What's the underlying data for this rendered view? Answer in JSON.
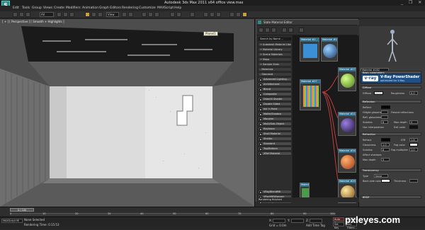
{
  "titlebar": {
    "app_logo": "S",
    "title": "Autodesk 3ds Max 2011 x64    office view.max",
    "window_controls": "_ ❐ ✕"
  },
  "menu": [
    "Edit",
    "Tools",
    "Group",
    "Views",
    "Create",
    "Modifiers",
    "Animation",
    "Graph Editors",
    "Rendering",
    "Customize",
    "MAXScript",
    "Help"
  ],
  "toolbar": {
    "selection_filter": "All",
    "reference_coord": "View"
  },
  "viewport": {
    "label": "[ + ] [ Perspective ] [ Smooth + Highlights ]",
    "badge": "Planel1"
  },
  "material_editor": {
    "title": "Slate Material Editor",
    "browser_items": [
      "Search by Name ...",
      "+ Autodesk Material Library",
      "+ Material Library",
      "+ Scene Materials",
      "+ Maps",
      "+ Sample Slots",
      "- Materials",
      "- Standard"
    ],
    "materials": [
      "Advanced Lighting...",
      "Architectural",
      "Blend",
      "Composite",
      "DirectX Shader",
      "Double Sided",
      "Ink 'n Paint",
      "Matte/Shadow",
      "Morpher",
      "Multi/Sub-Object",
      "Raytrace",
      "Shell Material",
      "Shellac",
      "Standard",
      "Top/Bottom",
      "XRef Material"
    ],
    "vray_items": [
      "VRayBlendMtl",
      "VRayMtlWrapper",
      "VRayLightMtl"
    ],
    "nodes": [
      {
        "label": "Material #1..."
      },
      {
        "label": "Material #27"
      },
      {
        "label": "Material #21"
      },
      {
        "label": "Material #24"
      },
      {
        "label": "Material #29"
      },
      {
        "label": "Material #30"
      }
    ],
    "status": "Rendering finished"
  },
  "params": {
    "material_name": "Material #182",
    "basic_params": "Basic parameters",
    "vray_title": "V-Ray PowerShader",
    "vray_sub": "optimized for V-Ray",
    "vray_logo": "v·ray",
    "diffuse_section": "Diffuse",
    "diffuse": "Diffuse",
    "roughness": "Roughness",
    "roughness_value": "0.0",
    "reflection_section": "Reflection",
    "reflect": "Reflect",
    "hilight_gloss": "Hilight glossiness",
    "refl_gloss": "Refl. glossiness",
    "subdivs": "Subdivs",
    "subdivs_value": "8",
    "use_interp": "Use interpolation",
    "fresnel": "Fresnel reflections",
    "max_depth": "Max depth",
    "max_depth_value": "5",
    "exit_color": "Exit color",
    "refraction_section": "Refraction",
    "refract": "Refract",
    "ior": "IOR",
    "ior_value": "1.6",
    "glossiness": "Glossiness",
    "glossiness_value": "1.0",
    "fog_color": "Fog color",
    "fog_multiplier": "Fog multiplier",
    "fog_multiplier_value": "1.0",
    "affect_shadows": "Affect shadows",
    "translucency_section": "Translucency",
    "type": "Type",
    "type_value": "None",
    "back_side": "Back-side color",
    "thickness": "Thickness",
    "bottom_label": "BRDF"
  },
  "timeline": {
    "slider": "0 / 100",
    "ticks": [
      "0",
      "10",
      "20",
      "30",
      "40",
      "50",
      "60",
      "70",
      "80",
      "90",
      "100"
    ]
  },
  "status": {
    "maxscript": "MAXScript Mi",
    "none_selected": "None Selected",
    "render_time": "Rendering Time: 0:15:53",
    "x_label": "X:",
    "y_label": "Y:",
    "z_label": "Z:",
    "grid": "Grid = 0.0m",
    "auto_key": "Auto Key",
    "selected": "Selected",
    "set_key": "Set Key",
    "key_filters": "Key Filters...",
    "add_time_tag": "Add Time Tag"
  },
  "watermark": "pxleyes.com"
}
